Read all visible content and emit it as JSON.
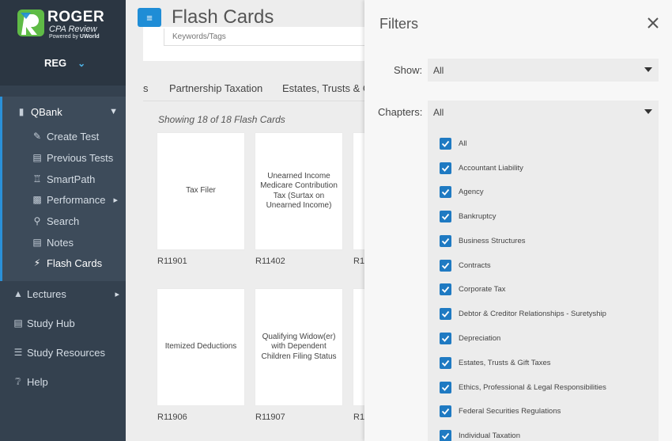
{
  "brand": {
    "title": "ROGER",
    "subtitle": "CPA Review",
    "powered_prefix": "Powered by ",
    "powered_by": "UWorld",
    "color": "#1f8dd6"
  },
  "exam": {
    "selected": "REG"
  },
  "nav": {
    "qbank": "QBank",
    "items": [
      {
        "label": "Create Test",
        "icon": "edit-icon"
      },
      {
        "label": "Previous Tests",
        "icon": "list-icon"
      },
      {
        "label": "SmartPath",
        "icon": "walk-icon"
      },
      {
        "label": "Performance",
        "icon": "bar-chart-icon"
      },
      {
        "label": "Search",
        "icon": "search-icon"
      },
      {
        "label": "Notes",
        "icon": "note-icon"
      },
      {
        "label": "Flash Cards",
        "icon": "bolt-icon"
      }
    ],
    "lectures": "Lectures",
    "study_hub": "Study Hub",
    "study_resources": "Study Resources",
    "help": "Help"
  },
  "main": {
    "title": "Flash Cards",
    "search_placeholder": "Keywords/Tags",
    "tabs": [
      "s",
      "Partnership Taxation",
      "Estates, Trusts & Gi"
    ],
    "showing": "Showing 18 of 18 Flash Cards",
    "cards": [
      {
        "text": "Tax Filer",
        "id": "R11901"
      },
      {
        "text": "Unearned Income Medicare Contribution Tax (Surtax on Unearned Income)",
        "id": "R11402"
      },
      {
        "text": "",
        "id": "R1"
      },
      {
        "text": "Itemized Deductions",
        "id": "R11906"
      },
      {
        "text": "Qualifying Widow(er) with Dependent Children Filing Status",
        "id": "R11907"
      },
      {
        "text": "",
        "id": "R1"
      }
    ]
  },
  "filters": {
    "title": "Filters",
    "show_label": "Show:",
    "show_value": "All",
    "chapters_label": "Chapters:",
    "chapters_value": "All",
    "chapters": [
      "All",
      "Accountant Liability",
      "Agency",
      "Bankruptcy",
      "Business Structures",
      "Contracts",
      "Corporate Tax",
      "Debtor & Creditor Relationships - Suretyship",
      "Depreciation",
      "Estates, Trusts & Gift Taxes",
      "Ethics, Professional & Legal Responsibilities",
      "Federal Securities Regulations",
      "Individual Taxation"
    ]
  }
}
